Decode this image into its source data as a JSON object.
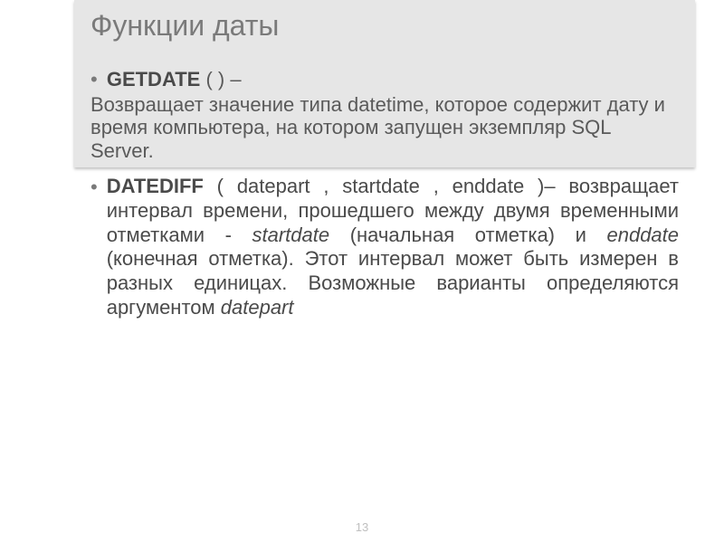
{
  "title": "Функции даты",
  "getdate": {
    "name": "GETDATE",
    "signature": "( ) ‒",
    "description": "Возвращает значение типа datetime, которое содержит дату и время компьютера, на котором запущен экземпляр SQL Server."
  },
  "datediff": {
    "name": "DATEDIFF",
    "signature": "( datepart , startdate , enddate )‒ возвращает интервал времени, прошедшего между двумя временными отметками - ",
    "startdate": "startdate",
    "mid1": " (начальная отметка) и ",
    "enddate": "enddate",
    "mid2": " (конечная отметка). Этот интервал может быть измерен в разных единицах. Возможные варианты определяются аргументом ",
    "datepart": "datepart"
  },
  "pageNumber": "13"
}
